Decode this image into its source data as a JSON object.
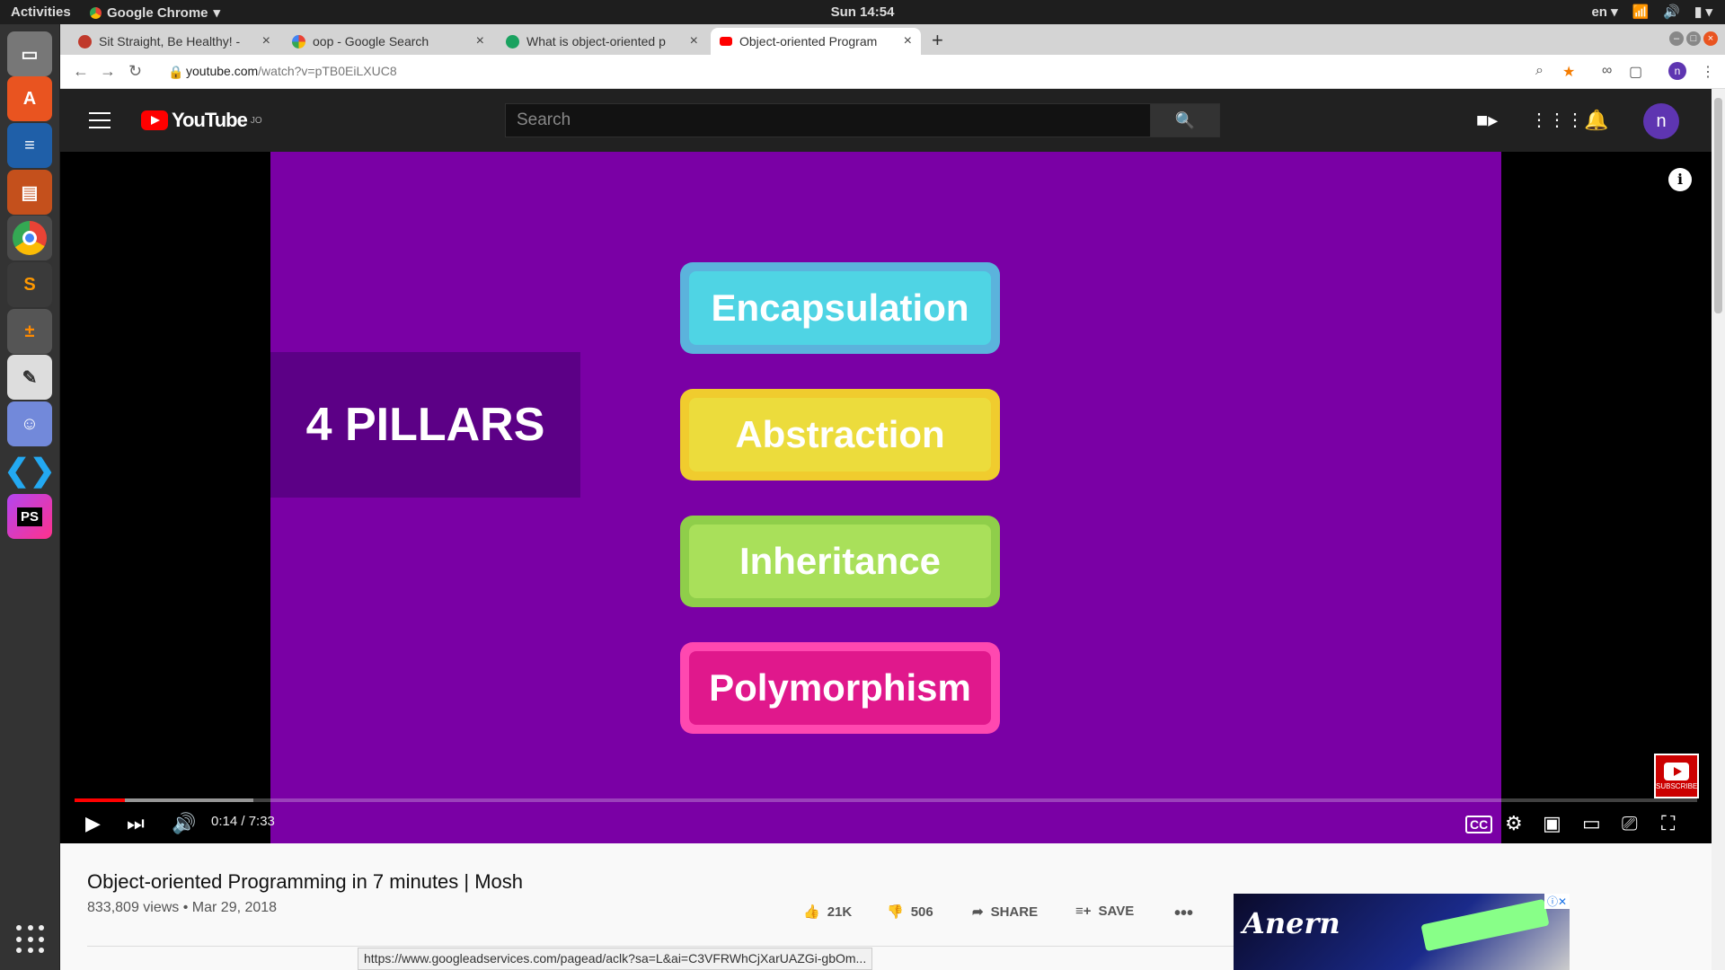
{
  "topbar": {
    "activities": "Activities",
    "app_name": "Google Chrome",
    "clock": "Sun 14:54",
    "lang": "en"
  },
  "dock": {
    "items": [
      "files",
      "software-center",
      "writer",
      "impress",
      "chrome",
      "sublime",
      "calculator",
      "text-editor",
      "discord",
      "vscode",
      "phpstorm"
    ]
  },
  "tabs": [
    {
      "title": "Sit Straight, Be Healthy! -",
      "fav_color": "#c0392b"
    },
    {
      "title": "oop - Google Search",
      "fav_color": "#4285f4"
    },
    {
      "title": "What is object-oriented p",
      "fav_color": "#1aa260"
    },
    {
      "title": "Object-oriented Program",
      "fav_color": "#ff0000"
    }
  ],
  "omnibox": {
    "domain": "youtube.com",
    "path": "/watch?v=pTB0EiLXUC8"
  },
  "youtube": {
    "logo_text": "YouTube",
    "region": "JO",
    "search_placeholder": "Search",
    "avatar_letter": "n"
  },
  "slide": {
    "heading": "4 PILLARS",
    "pillars": [
      {
        "label": "Encapsulation",
        "outer": "#5bb3dc",
        "inner": "#4fd4e4"
      },
      {
        "label": "Abstraction",
        "outer": "#f0cc2e",
        "inner": "#ecdc3c"
      },
      {
        "label": "Inheritance",
        "outer": "#8fce4a",
        "inner": "#a9e05a"
      },
      {
        "label": "Polymorphism",
        "outer": "#ff48b0",
        "inner": "#e0188c"
      }
    ]
  },
  "player": {
    "time": "0:14 / 7:33",
    "progress": 0.031,
    "buffered": 0.11,
    "watermark": "SUBSCRIBE"
  },
  "video": {
    "title": "Object-oriented Programming in 7 minutes | Mosh",
    "views": "833,809 views",
    "date": "Mar 29, 2018",
    "likes": "21K",
    "dislikes": "506",
    "share": "SHARE",
    "save": "SAVE"
  },
  "ad": {
    "brand": "Anern"
  },
  "status_url": "https://www.googleadservices.com/pagead/aclk?sa=L&ai=C3VFRWhCjXarUAZGi-gbOm..."
}
